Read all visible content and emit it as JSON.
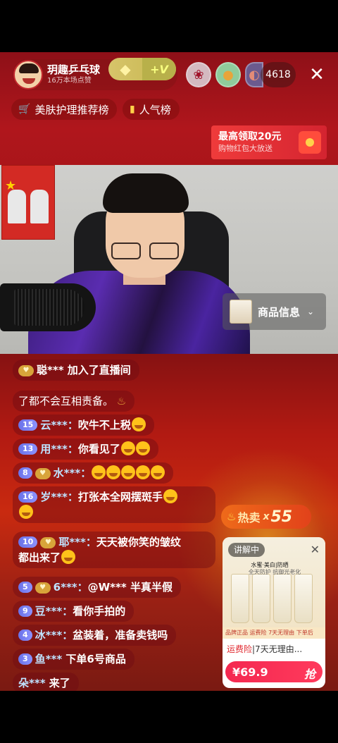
{
  "header": {
    "host_name": "玥趣乒乓球",
    "host_sub": "16万本场点赞",
    "v_badge": "+V",
    "viewer_count": "4618",
    "close_icon": "close-icon"
  },
  "chips": {
    "beauty_rank": "美肤护理推荐榜",
    "popularity_rank": "人气榜"
  },
  "red_packet": {
    "title": "最高领取20元",
    "subtitle": "购物红包大放送"
  },
  "product_info": {
    "label": "商品信息"
  },
  "chat": {
    "join_notice": {
      "name": "聪***",
      "text": " 加入了直播间"
    },
    "partial": "了都不会互相责备。",
    "messages": [
      {
        "level": "15",
        "nick": "云***：",
        "text": "吹牛不上税"
      },
      {
        "level": "13",
        "nick": "用***：",
        "text": "你看见了"
      },
      {
        "level": "8",
        "nick": "水***：",
        "text": ""
      },
      {
        "level": "16",
        "nick": "岁***：",
        "text": "打张本全网摆斑手"
      },
      {
        "level": "10",
        "nick": "耶***：",
        "text": "天天被你笑的皱纹",
        "text2": "都出来了"
      },
      {
        "level": "5",
        "nick": "6***：",
        "text": "@W*** 半真半假"
      },
      {
        "level": "9",
        "nick": "豆***：",
        "text": "看你手拍的"
      },
      {
        "level": "4",
        "nick": "冰***：",
        "text": "盆装着，准备卖钱吗"
      },
      {
        "level": "3",
        "nick": "鱼***",
        "text": " 下单6号商品"
      }
    ],
    "arrival": {
      "name": "朵***",
      "text": " 来了"
    }
  },
  "hot_sale": {
    "label": "热卖",
    "x": "x",
    "count": "55"
  },
  "product_card": {
    "explaining": "讲解中",
    "tag1": "水蜜·美白|防晒",
    "tag2": "全天防护 抗御光老化",
    "strip": "品牌正品  运费险  7天无理由  下单后",
    "insurance": "运费险",
    "desc": "|7天无理由...",
    "price": "¥69.9",
    "grab": "抢"
  }
}
